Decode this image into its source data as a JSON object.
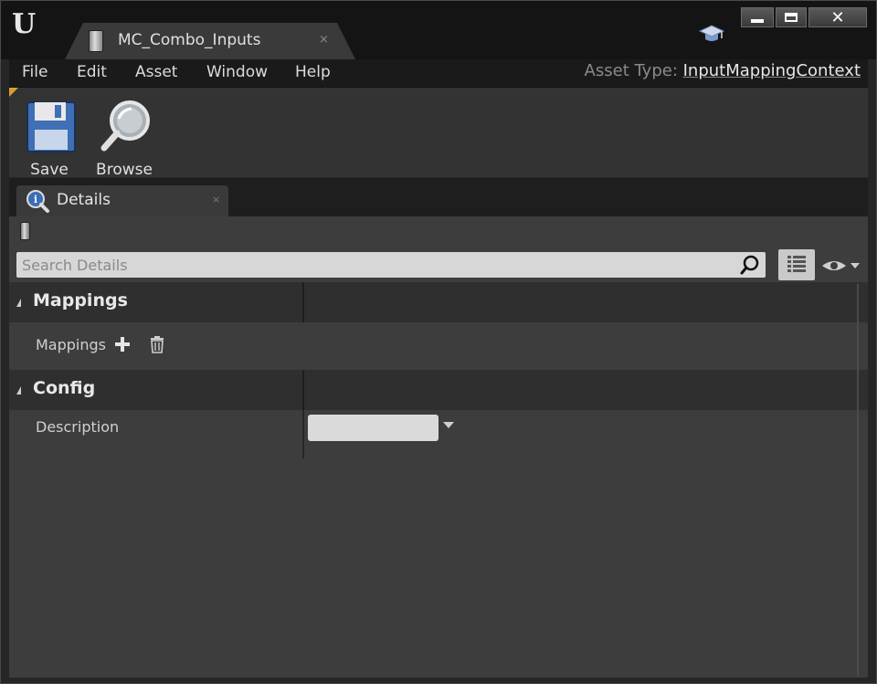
{
  "window": {
    "tab_title": "MC_Combo_Inputs",
    "tab_close": "×",
    "close_glyph": "✕"
  },
  "menu": {
    "items": [
      "File",
      "Edit",
      "Asset",
      "Window",
      "Help"
    ],
    "asset_type_label": "Asset Type:",
    "asset_type_value": "InputMappingContext"
  },
  "toolbar": {
    "save_label": "Save",
    "browse_label": "Browse"
  },
  "details_tab": {
    "label": "Details",
    "close": "×"
  },
  "search": {
    "placeholder": "Search Details"
  },
  "categories": {
    "mappings": {
      "label": "Mappings",
      "property_label": "Mappings"
    },
    "config": {
      "label": "Config",
      "property_label": "Description",
      "description_value": ""
    }
  },
  "icons": {
    "engine_logo": "unreal-logo-icon",
    "asset": "data-asset-icon",
    "learn": "graduation-cap-icon",
    "save": "floppy-disk-icon",
    "browse": "magnifier-icon",
    "details": "info-magnifier-icon",
    "search": "search-icon",
    "view_options": "grid-view-icon",
    "visibility": "eye-icon",
    "add": "plus-icon",
    "delete": "trash-icon"
  },
  "colors": {
    "accent_corner": "#d8a030",
    "background": "#3d3d3d",
    "titlebar": "#141414"
  }
}
